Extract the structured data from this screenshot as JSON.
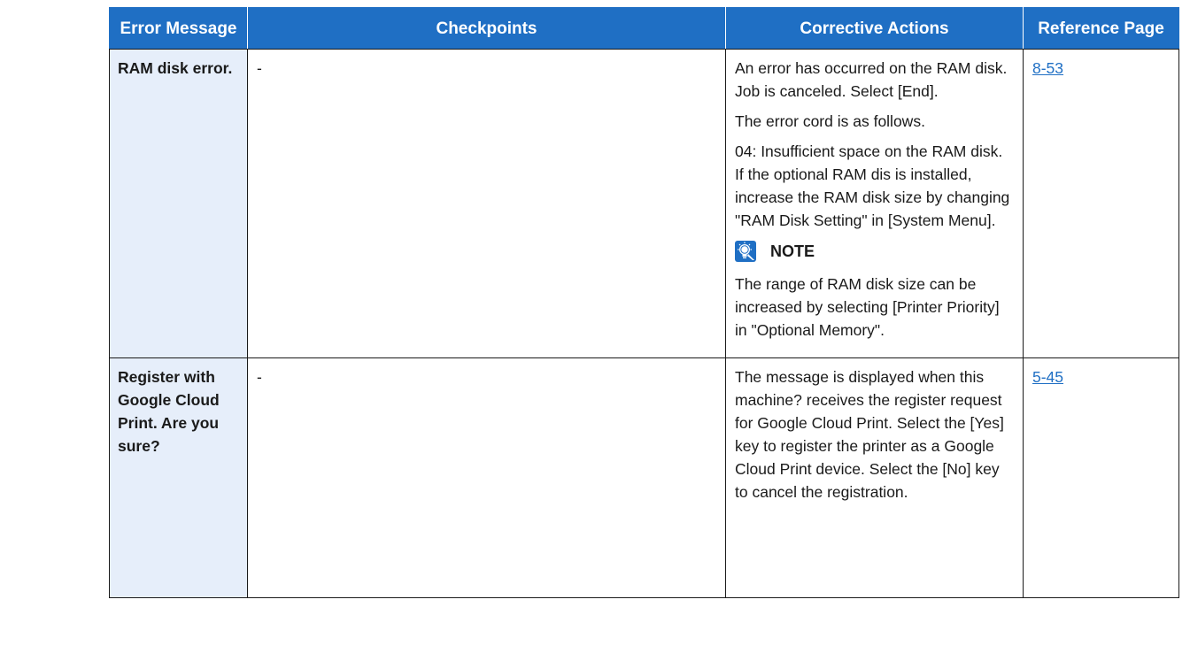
{
  "table": {
    "headers": {
      "error_message": "Error Message",
      "checkpoints": "Checkpoints",
      "corrective_actions": "Corrective Actions",
      "reference_page": "Reference Page"
    },
    "rows": [
      {
        "error_message": "RAM disk error.",
        "checkpoints": "-",
        "actions": [
          "An error has occurred on the RAM disk. Job is canceled. Select [End].",
          "The error cord is as follows.",
          "04: Insufficient space on the RAM disk. If the optional RAM dis is installed, increase the RAM disk size by changing \"RAM Disk Setting\" in [System Menu]."
        ],
        "note": {
          "icon": "lightbulb-note-icon",
          "label": "NOTE",
          "text": "The range of RAM disk size can be increased by selecting [Printer Priority] in \"Optional Memory\"."
        },
        "reference": "8-53"
      },
      {
        "error_message": "Register with Google Cloud Print. Are you sure?",
        "checkpoints": "-",
        "actions": [
          "The message is displayed when this machine? receives the register request for Google Cloud Print. Select the [Yes] key to register the printer as a Google Cloud Print device. Select the [No] key to cancel the registration."
        ],
        "reference": "5-45"
      }
    ]
  },
  "colors": {
    "header_bg": "#1f6fc4",
    "header_text": "#ffffff",
    "message_cell_bg": "#e6eefa",
    "link": "#1f6fc4"
  }
}
